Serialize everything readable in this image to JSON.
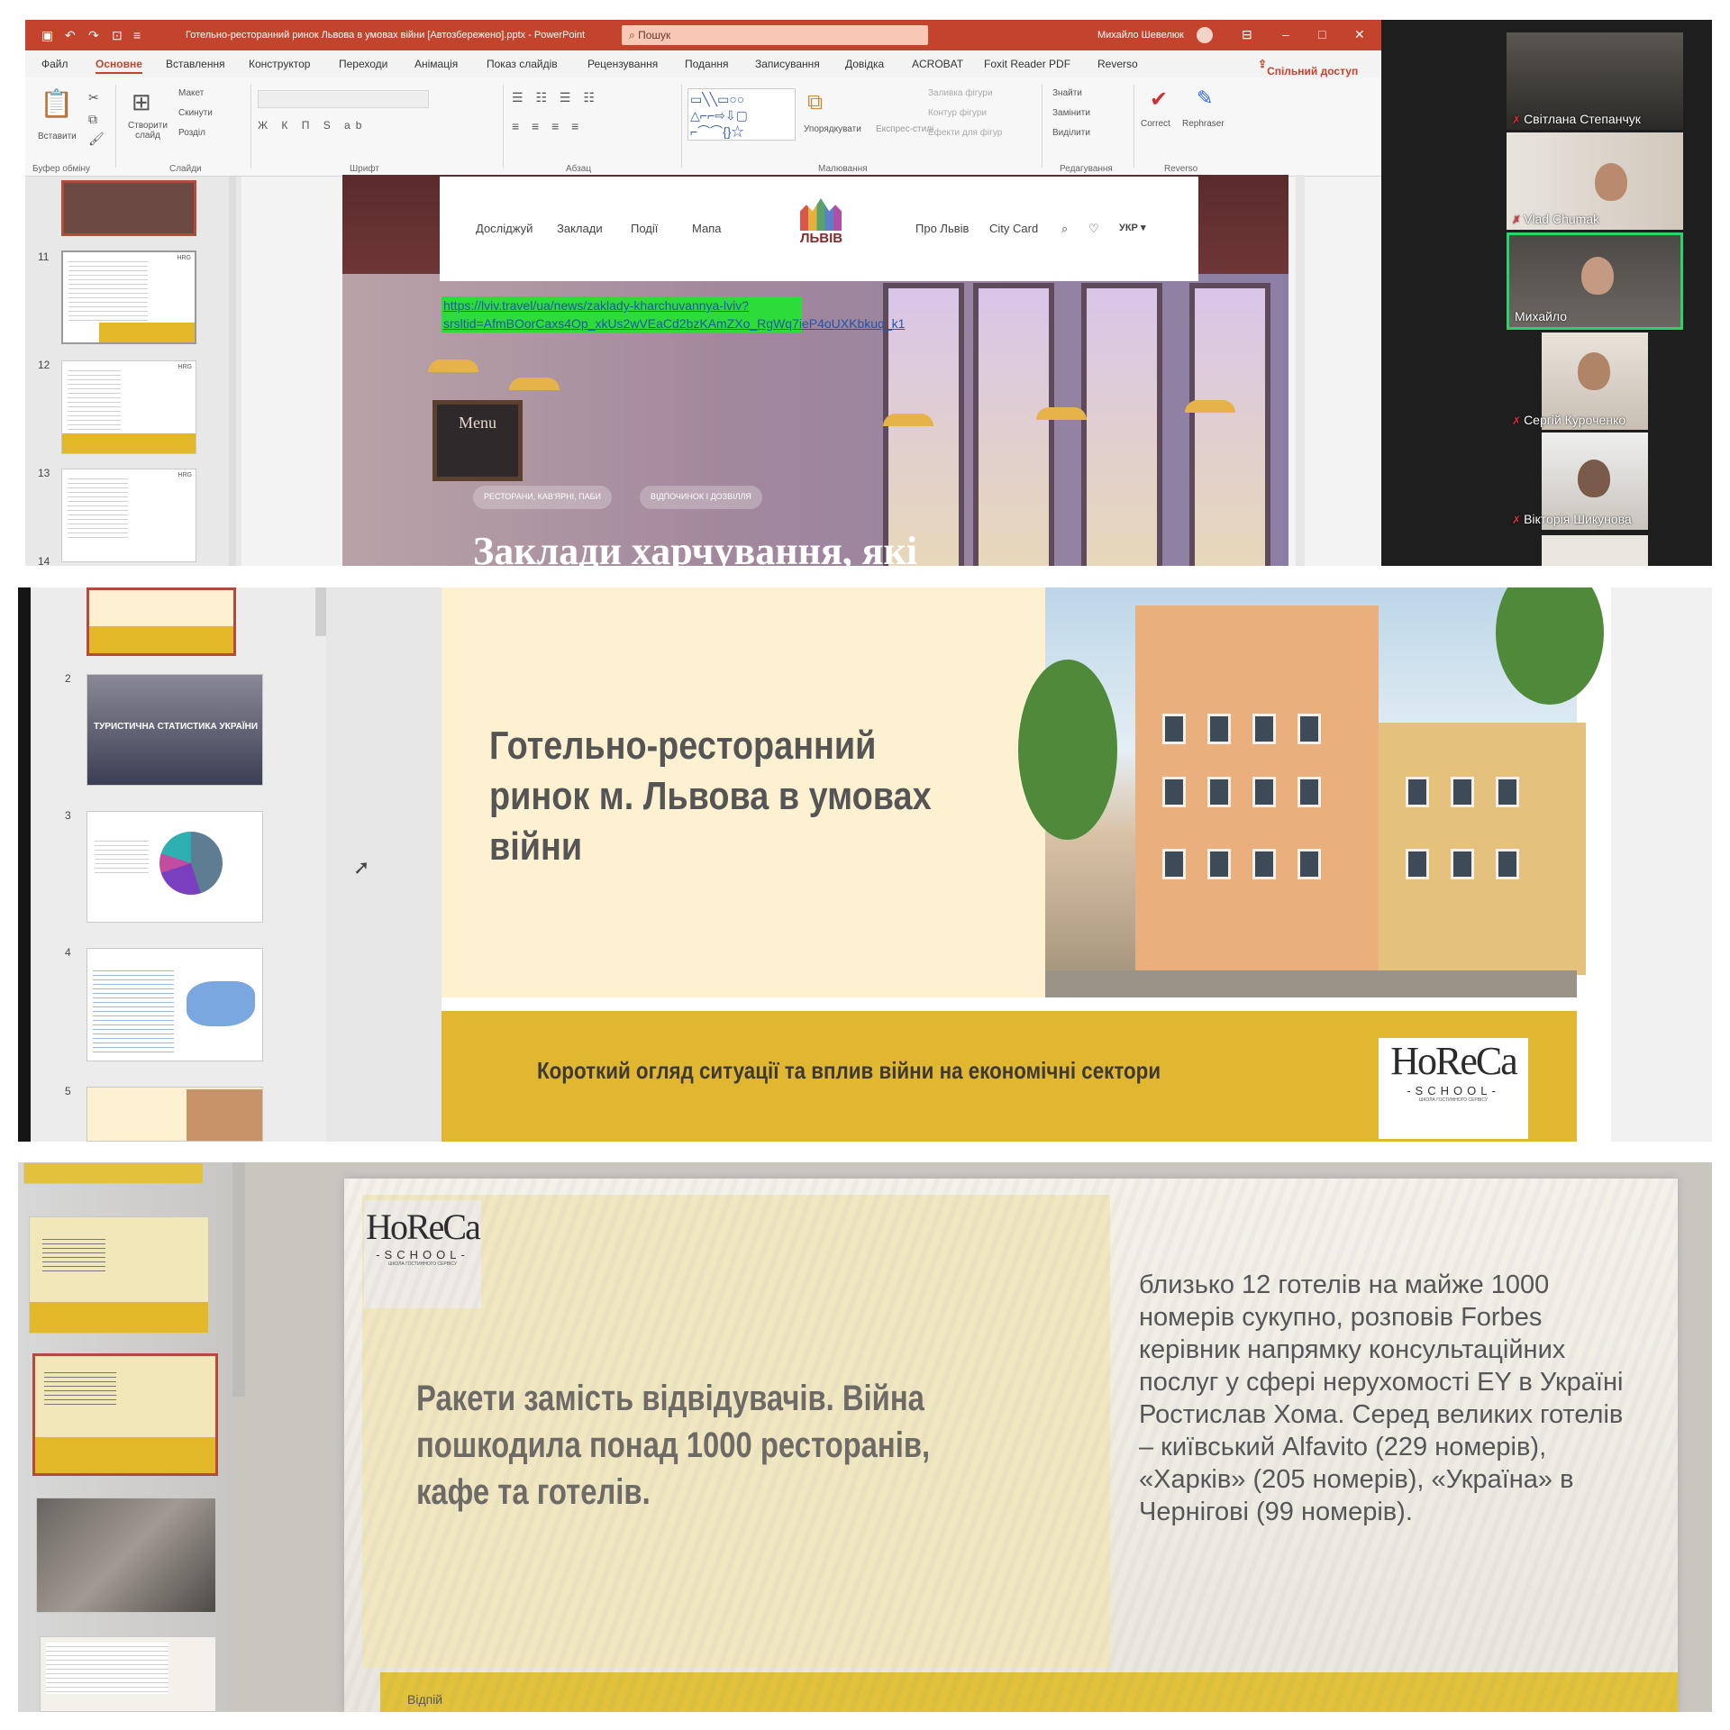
{
  "panel1": {
    "ppt": {
      "file_title": "Готельно-ресторанний ринок Львова в умовах війни [Автозбережено].pptx - PowerPoint",
      "search_placeholder": "Пошук",
      "user_name": "Михайло Шевелюк",
      "tabs": [
        "Файл",
        "Основне",
        "Вставлення",
        "Конструктор",
        "Переходи",
        "Анімація",
        "Показ слайдів",
        "Рецензування",
        "Подання",
        "Записування",
        "Довідка",
        "ACROBAT",
        "Foxit Reader PDF",
        "Reverso"
      ],
      "active_tab": "Основне",
      "share_label": "Спільний доступ",
      "ribbon_groups": [
        "Буфер обміну",
        "Слайди",
        "Шрифт",
        "Абзац",
        "Малювання",
        "Редагування",
        "Reverso"
      ],
      "ribbon_buttons": {
        "paste": "Вставити",
        "new_slide": "Створити слайд",
        "layout": "Макет",
        "reset": "Скинути",
        "section": "Розділ",
        "arrange": "Упорядкувати",
        "quick_styles": "Експрес-стилі",
        "fill": "Заливка фігури",
        "outline": "Контур фігури",
        "effects": "Ефекти для фігур",
        "find": "Знайти",
        "replace": "Замінити",
        "select": "Виділити",
        "correct": "Correct",
        "rephraser": "Rephraser"
      },
      "thumb_numbers": [
        "11",
        "12",
        "13",
        "14"
      ]
    },
    "website": {
      "nav_left": [
        "Досліджуй",
        "Заклади",
        "Події",
        "Мапа"
      ],
      "logo_text": "ЛЬВІВ",
      "nav_right": [
        "Про Львів",
        "City Card",
        "УКР ▾"
      ],
      "url_text": "https://lviv.travel/ua/news/zaklady-kharchuvannya-lviv?srsltid=AfmBOorCaxs4Op_xkUs2wVEaCd2bzKAmZXo_RgWq7ieP4oUXKbkuq_k1",
      "menu_board": "Menu",
      "chips": [
        "РЕСТОРАНИ, КАВ'ЯРНІ, ПАБИ",
        "ВІДПОЧИНОК І ДОЗВІЛЛЯ"
      ],
      "heading": "Заклади харчування, які"
    },
    "zoom": {
      "participants": [
        "Світлана Степанчук",
        "Vlad Chumak",
        "Михайло",
        "Сергій Курoченко",
        "Вікторія Шикунова"
      ]
    }
  },
  "panel2": {
    "thumb_numbers": [
      "2",
      "3",
      "4",
      "5"
    ],
    "thumb2_title": "ТУРИСТИЧНА СТАТИСТИКА УКРАЇНИ",
    "title": "Готельно-ресторанний ринок м. Львова в умовах війни",
    "subtitle": "Короткий огляд ситуації та вплив війни на економічні сектори",
    "logo": {
      "main": "HoReCa",
      "school": "-SCHOOL-",
      "tagline": "ШКОЛА ГОСТИННОГО СЕРВІСУ"
    }
  },
  "panel3": {
    "title": "Ракети замість відвідувачів. Війна пошкодила понад 1000 ресторанів, кафе та готелів.",
    "body": "близько 12 готелів на майже 1000 номерів сукупно, розповів Forbes керівник напрямку консультаційних послуг у сфері нерухомості EY в Україні Ростислав Хома. Серед великих готелів – київський Alfavito (229 номерів), «Харків» (205 номерів), «Україна» в Чернігові (99 номерів).",
    "logo": {
      "main": "HoReCa",
      "school": "-SCHOOL-",
      "tagline": "ШКОЛА ГОСТИННОГО СЕРВІСУ"
    },
    "footer_fragment": "Відпій"
  },
  "colors": {
    "ppt_red": "#c4432c",
    "gold": "#e1b631",
    "cream": "#fdf1d2",
    "zoom_active": "#2bd36a",
    "url_highlight": "#2ddc3a"
  }
}
